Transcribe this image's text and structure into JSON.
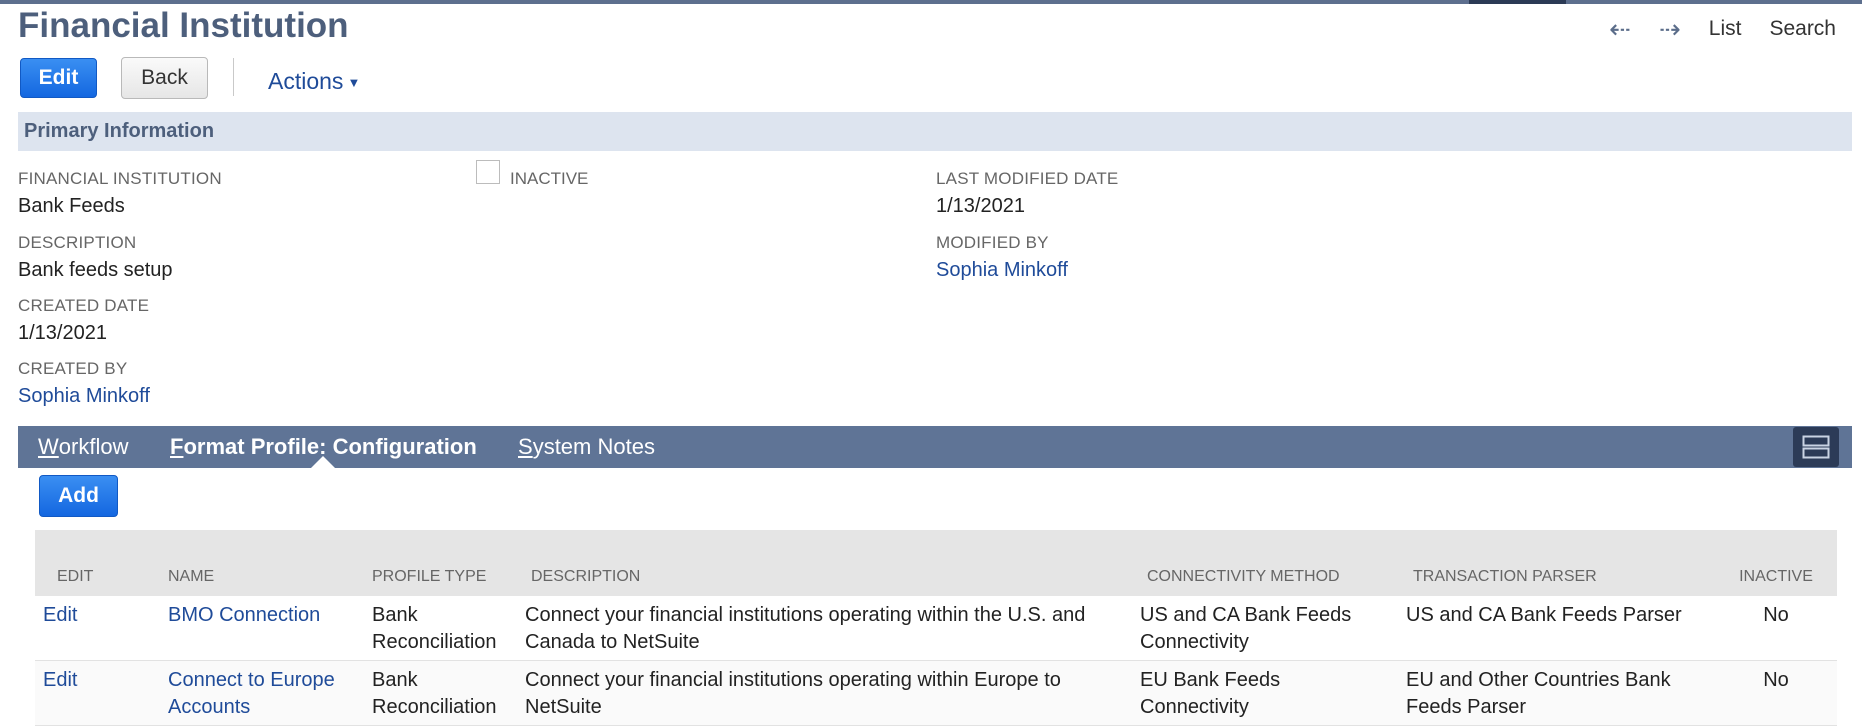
{
  "page": {
    "title": "Financial Institution"
  },
  "nav": {
    "back_icon": "arrow-left-icon",
    "forward_icon": "arrow-right-icon",
    "list_label": "List",
    "search_label": "Search"
  },
  "toolbar": {
    "edit_label": "Edit",
    "back_label": "Back",
    "actions_label": "Actions"
  },
  "primary": {
    "section_title": "Primary Information",
    "financial_institution_label": "FINANCIAL INSTITUTION",
    "financial_institution_value": "Bank Feeds",
    "description_label": "DESCRIPTION",
    "description_value": "Bank feeds setup",
    "created_date_label": "CREATED DATE",
    "created_date_value": "1/13/2021",
    "created_by_label": "CREATED BY",
    "created_by_value": "Sophia Minkoff",
    "inactive_label": "INACTIVE",
    "inactive_checked": false,
    "last_modified_label": "LAST MODIFIED DATE",
    "last_modified_value": "1/13/2021",
    "modified_by_label": "MODIFIED BY",
    "modified_by_value": "Sophia Minkoff"
  },
  "tabs": [
    {
      "label_first": "W",
      "label_rest": "orkflow",
      "active": false
    },
    {
      "label_first": "F",
      "label_rest": "ormat Profile: Configuration",
      "active": true
    },
    {
      "label_first": "S",
      "label_rest": "ystem Notes",
      "active": false
    }
  ],
  "sublist": {
    "add_label": "Add",
    "columns": [
      "EDIT",
      "NAME",
      "PROFILE TYPE",
      "DESCRIPTION",
      "CONNECTIVITY METHOD",
      "TRANSACTION PARSER",
      "INACTIVE"
    ],
    "rows": [
      {
        "edit": "Edit",
        "name": "BMO Connection",
        "profile_type": "Bank Reconciliation",
        "description": "Connect your financial institutions operating within the U.S. and Canada to NetSuite",
        "connectivity": "US and CA Bank Feeds Connectivity",
        "parser": "US and CA Bank Feeds Parser",
        "inactive": "No"
      },
      {
        "edit": "Edit",
        "name": "Connect to Europe Accounts",
        "profile_type": "Bank Reconciliation",
        "description": "Connect your financial institutions operating within Europe to NetSuite",
        "connectivity": "EU Bank Feeds Connectivity",
        "parser": "EU and Other Countries Bank Feeds Parser",
        "inactive": "No"
      }
    ]
  },
  "colors": {
    "header_text": "#4d5f7c",
    "tab_bar": "#5f7496",
    "primary_button": "#1467e0",
    "link": "#1f4b99"
  }
}
